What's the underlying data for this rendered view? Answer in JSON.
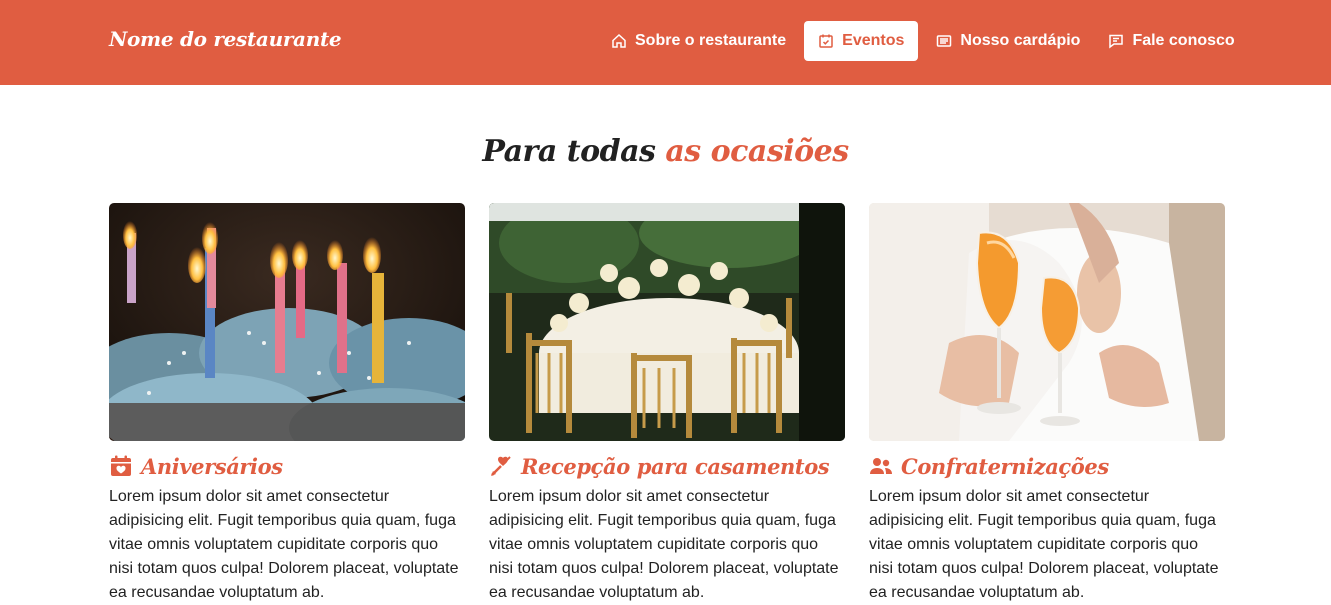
{
  "brand": "Nome do restaurante",
  "nav": [
    {
      "label": "Sobre o restaurante",
      "icon": "home-icon"
    },
    {
      "label": "Eventos",
      "icon": "calendar-icon",
      "active": true
    },
    {
      "label": "Nosso cardápio",
      "icon": "menu-list-icon"
    },
    {
      "label": "Fale conosco",
      "icon": "chat-icon"
    }
  ],
  "section": {
    "title_main": "Para todas ",
    "title_accent": "as ocasiões"
  },
  "colors": {
    "primary": "#e05d41",
    "text": "#222222",
    "white": "#ffffff"
  },
  "cards": [
    {
      "title": "Aniversários",
      "icon": "calendar-heart-icon",
      "text": "Lorem ipsum dolor sit amet consectetur adipisicing elit. Fugit temporibus quia quam, fuga vitae omnis voluptatem cupiditate corporis quo nisi totam quos culpa! Dolorem placeat, voluptate ea recusandae voluptatum ab."
    },
    {
      "title": "Recepção para casamentos",
      "icon": "cupid-arrow-icon",
      "text": "Lorem ipsum dolor sit amet consectetur adipisicing elit. Fugit temporibus quia quam, fuga vitae omnis voluptatem cupiditate corporis quo nisi totam quos culpa! Dolorem placeat, voluptate ea recusandae voluptatum ab."
    },
    {
      "title": "Confraternizações",
      "icon": "users-icon",
      "text": "Lorem ipsum dolor sit amet consectetur adipisicing elit. Fugit temporibus quia quam, fuga vitae omnis voluptatem cupiditate corporis quo nisi totam quos culpa! Dolorem placeat, voluptate ea recusandae voluptatum ab."
    }
  ]
}
